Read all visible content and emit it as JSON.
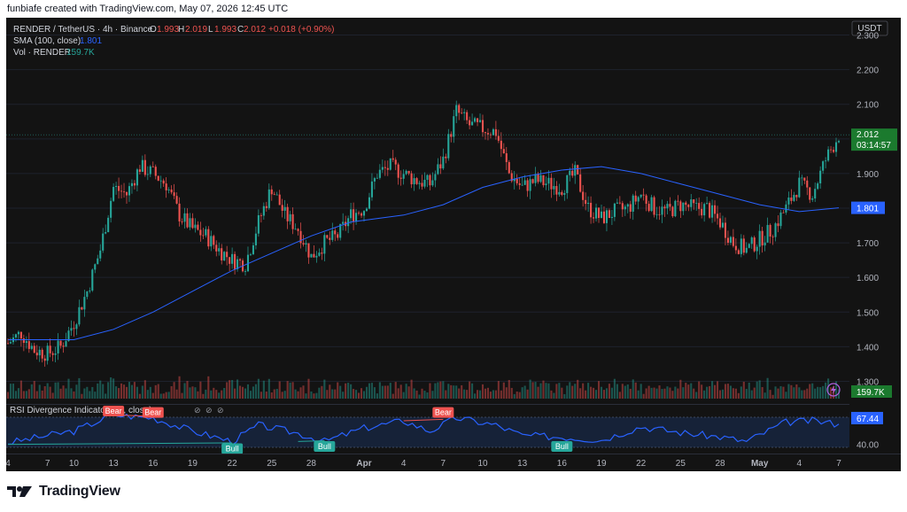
{
  "header": {
    "credit": "funbiafe created with TradingView.com, May 07, 2026 12:45 UTC"
  },
  "legend": {
    "symbol": "RENDER / TetherUS · 4h · Binance",
    "o_label": "O",
    "o_value": "1.993",
    "h_label": "H",
    "h_value": "2.019",
    "l_label": "L",
    "l_value": "1.993",
    "c_label": "C",
    "c_value": "2.012",
    "change": "+0.018 (+0.90%)",
    "sma_label": "SMA (100, close)",
    "sma_value": "1.801",
    "vol_label": "Vol · RENDER",
    "vol_value": "159.7K"
  },
  "price_axis": {
    "currency": "USDT",
    "ticks": [
      "2.300",
      "2.200",
      "2.100",
      "2.000",
      "1.900",
      "1.800",
      "1.700",
      "1.600",
      "1.500",
      "1.400",
      "1.300"
    ],
    "last_price": "2.012",
    "countdown": "03:14:57",
    "sma_badge": "1.801",
    "vol_badge": "159.7K"
  },
  "rsi": {
    "label": "RSI Divergence Indicator (14, close)",
    "value": "67.44",
    "ticks": [
      "80.00",
      "40.00"
    ],
    "signals": [
      {
        "text": "Bear",
        "type": "bear"
      },
      {
        "text": "Bear",
        "type": "bear"
      },
      {
        "text": "Bear",
        "type": "bear"
      },
      {
        "text": "Bull",
        "type": "bull"
      },
      {
        "text": "Bull",
        "type": "bull"
      },
      {
        "text": "Bull",
        "type": "bull"
      }
    ]
  },
  "time_axis": [
    "4",
    "7",
    "10",
    "13",
    "16",
    "19",
    "22",
    "25",
    "28",
    "Apr",
    "4",
    "7",
    "10",
    "13",
    "16",
    "19",
    "22",
    "25",
    "28",
    "May",
    "4",
    "7"
  ],
  "colors": {
    "up": "#26a69a",
    "down": "#ef5350",
    "sma": "#2962ff",
    "rsi": "#2962ff",
    "last_price": "#1b7a2e"
  },
  "brand": {
    "name": "TradingView"
  },
  "chart_data": {
    "type": "candlestick",
    "symbol": "RENDER/USDT",
    "interval": "4h",
    "ylim": [
      1.25,
      2.35
    ],
    "close_path": [
      {
        "x": "Mar 4",
        "y": 1.41
      },
      {
        "x": "Mar 5",
        "y": 1.44
      },
      {
        "x": "Mar 6",
        "y": 1.39
      },
      {
        "x": "Mar 7",
        "y": 1.38
      },
      {
        "x": "Mar 9",
        "y": 1.4
      },
      {
        "x": "Mar 10",
        "y": 1.47
      },
      {
        "x": "Mar 11",
        "y": 1.56
      },
      {
        "x": "Mar 12",
        "y": 1.68
      },
      {
        "x": "Mar 13",
        "y": 1.86
      },
      {
        "x": "Mar 14",
        "y": 1.84
      },
      {
        "x": "Mar 15",
        "y": 1.92
      },
      {
        "x": "Mar 16",
        "y": 1.9
      },
      {
        "x": "Mar 17",
        "y": 1.87
      },
      {
        "x": "Mar 18",
        "y": 1.78
      },
      {
        "x": "Mar 19",
        "y": 1.74
      },
      {
        "x": "Mar 20",
        "y": 1.72
      },
      {
        "x": "Mar 21",
        "y": 1.68
      },
      {
        "x": "Mar 22",
        "y": 1.65
      },
      {
        "x": "Mar 23",
        "y": 1.64
      },
      {
        "x": "Mar 24",
        "y": 1.76
      },
      {
        "x": "Mar 25",
        "y": 1.86
      },
      {
        "x": "Mar 26",
        "y": 1.78
      },
      {
        "x": "Mar 27",
        "y": 1.74
      },
      {
        "x": "Mar 28",
        "y": 1.66
      },
      {
        "x": "Mar 29",
        "y": 1.7
      },
      {
        "x": "Mar 30",
        "y": 1.72
      },
      {
        "x": "Mar 31",
        "y": 1.78
      },
      {
        "x": "Apr 1",
        "y": 1.8
      },
      {
        "x": "Apr 2",
        "y": 1.9
      },
      {
        "x": "Apr 3",
        "y": 1.92
      },
      {
        "x": "Apr 4",
        "y": 1.9
      },
      {
        "x": "Apr 5",
        "y": 1.88
      },
      {
        "x": "Apr 6",
        "y": 1.87
      },
      {
        "x": "Apr 7",
        "y": 1.94
      },
      {
        "x": "Apr 8",
        "y": 2.08
      },
      {
        "x": "Apr 9",
        "y": 2.04
      },
      {
        "x": "Apr 10",
        "y": 2.03
      },
      {
        "x": "Apr 11",
        "y": 2.02
      },
      {
        "x": "Apr 12",
        "y": 1.9
      },
      {
        "x": "Apr 13",
        "y": 1.86
      },
      {
        "x": "Apr 14",
        "y": 1.88
      },
      {
        "x": "Apr 15",
        "y": 1.87
      },
      {
        "x": "Apr 16",
        "y": 1.86
      },
      {
        "x": "Apr 17",
        "y": 1.9
      },
      {
        "x": "Apr 18",
        "y": 1.8
      },
      {
        "x": "Apr 19",
        "y": 1.77
      },
      {
        "x": "Apr 20",
        "y": 1.79
      },
      {
        "x": "Apr 21",
        "y": 1.8
      },
      {
        "x": "Apr 22",
        "y": 1.84
      },
      {
        "x": "Apr 23",
        "y": 1.8
      },
      {
        "x": "Apr 24",
        "y": 1.79
      },
      {
        "x": "Apr 25",
        "y": 1.81
      },
      {
        "x": "Apr 26",
        "y": 1.8
      },
      {
        "x": "Apr 27",
        "y": 1.8
      },
      {
        "x": "Apr 28",
        "y": 1.76
      },
      {
        "x": "Apr 29",
        "y": 1.7
      },
      {
        "x": "Apr 30",
        "y": 1.68
      },
      {
        "x": "May 1",
        "y": 1.71
      },
      {
        "x": "May 2",
        "y": 1.74
      },
      {
        "x": "May 3",
        "y": 1.8
      },
      {
        "x": "May 4",
        "y": 1.87
      },
      {
        "x": "May 5",
        "y": 1.84
      },
      {
        "x": "May 6",
        "y": 1.94
      },
      {
        "x": "May 7",
        "y": 2.012
      }
    ],
    "sma_path": [
      {
        "x": "Mar 4",
        "y": 1.42
      },
      {
        "x": "Mar 10",
        "y": 1.42
      },
      {
        "x": "Mar 13",
        "y": 1.45
      },
      {
        "x": "Mar 16",
        "y": 1.5
      },
      {
        "x": "Mar 19",
        "y": 1.56
      },
      {
        "x": "Mar 22",
        "y": 1.62
      },
      {
        "x": "Mar 25",
        "y": 1.67
      },
      {
        "x": "Mar 28",
        "y": 1.72
      },
      {
        "x": "Mar 31",
        "y": 1.76
      },
      {
        "x": "Apr 4",
        "y": 1.78
      },
      {
        "x": "Apr 7",
        "y": 1.81
      },
      {
        "x": "Apr 10",
        "y": 1.86
      },
      {
        "x": "Apr 13",
        "y": 1.89
      },
      {
        "x": "Apr 16",
        "y": 1.91
      },
      {
        "x": "Apr 19",
        "y": 1.92
      },
      {
        "x": "Apr 22",
        "y": 1.9
      },
      {
        "x": "Apr 25",
        "y": 1.87
      },
      {
        "x": "Apr 28",
        "y": 1.84
      },
      {
        "x": "May 1",
        "y": 1.81
      },
      {
        "x": "May 4",
        "y": 1.79
      },
      {
        "x": "May 7",
        "y": 1.801
      }
    ],
    "rsi_path": [
      {
        "x": "Mar 4",
        "y": 42
      },
      {
        "x": "Mar 7",
        "y": 52
      },
      {
        "x": "Mar 10",
        "y": 58
      },
      {
        "x": "Mar 13",
        "y": 80
      },
      {
        "x": "Mar 16",
        "y": 76
      },
      {
        "x": "Mar 19",
        "y": 58
      },
      {
        "x": "Mar 22",
        "y": 44
      },
      {
        "x": "Mar 24",
        "y": 66
      },
      {
        "x": "Mar 27",
        "y": 55
      },
      {
        "x": "Mar 29",
        "y": 44
      },
      {
        "x": "Apr 1",
        "y": 62
      },
      {
        "x": "Apr 4",
        "y": 72
      },
      {
        "x": "Apr 6",
        "y": 58
      },
      {
        "x": "Apr 8",
        "y": 76
      },
      {
        "x": "Apr 11",
        "y": 66
      },
      {
        "x": "Apr 13",
        "y": 52
      },
      {
        "x": "Apr 16",
        "y": 50
      },
      {
        "x": "Apr 19",
        "y": 46
      },
      {
        "x": "Apr 22",
        "y": 64
      },
      {
        "x": "Apr 25",
        "y": 56
      },
      {
        "x": "Apr 28",
        "y": 50
      },
      {
        "x": "Apr 30",
        "y": 44
      },
      {
        "x": "May 3",
        "y": 70
      },
      {
        "x": "May 5",
        "y": 72
      },
      {
        "x": "May 7",
        "y": 67.44
      }
    ],
    "rsi_ylim": [
      30,
      90
    ]
  }
}
